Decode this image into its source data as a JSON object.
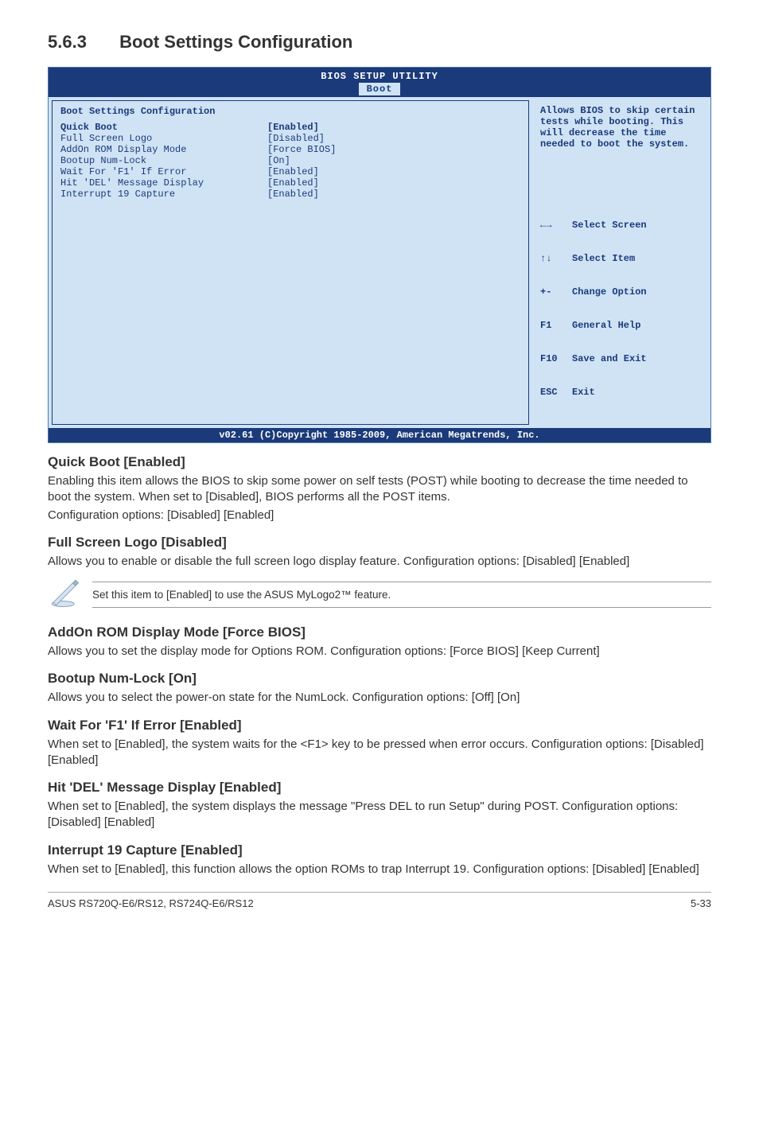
{
  "section": {
    "number": "5.6.3",
    "title": "Boot Settings Configuration"
  },
  "bios": {
    "header": "BIOS SETUP UTILITY",
    "tab": "Boot",
    "panel_title": "Boot Settings Configuration",
    "items": [
      {
        "label": "Quick Boot",
        "value": "[Enabled]"
      },
      {
        "label": "Full Screen Logo",
        "value": "[Disabled]"
      },
      {
        "label": "AddOn ROM Display Mode",
        "value": "[Force BIOS]"
      },
      {
        "label": "Bootup Num-Lock",
        "value": "[On]"
      },
      {
        "label": "Wait For 'F1' If Error",
        "value": "[Enabled]"
      },
      {
        "label": "Hit 'DEL' Message Display",
        "value": "[Enabled]"
      },
      {
        "label": "Interrupt 19 Capture",
        "value": "[Enabled]"
      }
    ],
    "help": "Allows BIOS to skip certain tests while booting. This will decrease the time needed to boot the system.",
    "keys": [
      {
        "k": "←→",
        "t": "Select Screen"
      },
      {
        "k": "↑↓",
        "t": "Select Item"
      },
      {
        "k": "+-",
        "t": "Change Option"
      },
      {
        "k": "F1",
        "t": "General Help"
      },
      {
        "k": "F10",
        "t": "Save and Exit"
      },
      {
        "k": "ESC",
        "t": "Exit"
      }
    ],
    "footer": "v02.61 (C)Copyright 1985-2009, American Megatrends, Inc."
  },
  "subs": {
    "quickboot": {
      "h": "Quick Boot [Enabled]",
      "p1": "Enabling this item allows the BIOS to skip some power on self tests (POST) while booting to decrease the time needed to boot the system. When set to [Disabled], BIOS performs all the POST items.",
      "p2": "Configuration options: [Disabled] [Enabled]"
    },
    "fullscreen": {
      "h": "Full Screen Logo [Disabled]",
      "p1": "Allows you to enable or disable the full screen logo display feature. Configuration options: [Disabled] [Enabled]"
    },
    "note": "Set this item to [Enabled] to use the ASUS MyLogo2™ feature.",
    "addon": {
      "h": "AddOn ROM Display Mode [Force BIOS]",
      "p1": "Allows you to set the display mode for Options ROM. Configuration options: [Force BIOS] [Keep Current]"
    },
    "numlock": {
      "h": "Bootup Num-Lock [On]",
      "p1": "Allows you to select the power-on state for the NumLock. Configuration options: [Off] [On]"
    },
    "waitf1": {
      "h": "Wait For 'F1' If Error [Enabled]",
      "p1": "When set to [Enabled], the system waits for the <F1> key to be pressed when error occurs. Configuration options: [Disabled] [Enabled]"
    },
    "hitdel": {
      "h": "Hit 'DEL' Message Display [Enabled]",
      "p1": "When set to [Enabled], the system displays the message \"Press DEL to run Setup\" during POST. Configuration options: [Disabled] [Enabled]"
    },
    "int19": {
      "h": "Interrupt 19 Capture [Enabled]",
      "p1": "When set to [Enabled], this function allows the option ROMs to trap Interrupt 19. Configuration options: [Disabled] [Enabled]"
    }
  },
  "footer": {
    "left": "ASUS RS720Q-E6/RS12, RS724Q-E6/RS12",
    "right": "5-33"
  }
}
